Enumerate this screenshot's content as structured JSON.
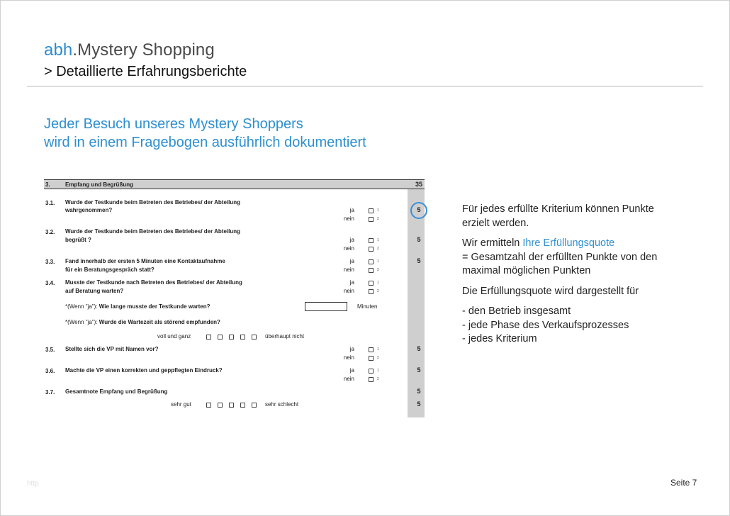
{
  "header": {
    "brand_accent": "abh",
    "brand_rest": ".Mystery Shopping",
    "subtitle": "> Detaillierte Erfahrungsberichte"
  },
  "headline": {
    "line1": "Jeder Besuch unseres Mystery Shoppers",
    "line2": "wird in einem Fragebogen ausführlich dokumentiert"
  },
  "form": {
    "section": {
      "num": "3.",
      "title": "Empfang und Begrüßung",
      "points": "35"
    },
    "questions": [
      {
        "num": "3.1.",
        "line1": "Wurde der Testkunde beim Betreten des Betriebes/ der Abteilung",
        "line2": "wahrgenommen?",
        "yes": "ja",
        "no": "nein",
        "c1": "1",
        "c2": "2",
        "points": "5"
      },
      {
        "num": "3.2.",
        "line1": "Wurde der Testkunde beim Betreten des Betriebes/ der Abteilung",
        "line2": "begrüßt ?",
        "yes": "ja",
        "no": "nein",
        "c1": "1",
        "c2": "2",
        "points": "5"
      },
      {
        "num": "3.3.",
        "line1": "Fand innerhalb der ersten 5 Minuten eine Kontaktaufnahme",
        "line2": "für ein Beratungsgespräch statt?",
        "yes": "ja",
        "no": "nein",
        "c1": "1",
        "c2": "2",
        "points": "5"
      },
      {
        "num": "3.4.",
        "line1": "Musste der Testkunde nach Betreten des Betriebes/ der Abteilung",
        "line2": "auf Beratung warten?",
        "yes": "ja",
        "no": "nein",
        "c1": "1",
        "c2": "2"
      }
    ],
    "wait_prefix": "*(Wenn \"ja\"): ",
    "wait_question": "Wie lange musste der Testkunde warten?",
    "wait_unit": "Minuten",
    "disturb_prefix": "*(Wenn \"ja\"): ",
    "disturb_question": "Wurde die Wartezeit als störend empfunden?",
    "scale1_left": "voll und ganz",
    "scale1_right": "überhaupt nicht",
    "questions2": [
      {
        "num": "3.5.",
        "line1": "Stellte sich die VP mit Namen vor?",
        "yes": "ja",
        "no": "nein",
        "c1": "1",
        "c2": "2",
        "points": "5"
      },
      {
        "num": "3.6.",
        "line1": "Machte die VP einen korrekten und geppflegten Eindruck?",
        "yes": "ja",
        "no": "nein",
        "c1": "1",
        "c2": "2",
        "points": "5"
      }
    ],
    "overall": {
      "num": "3.7.",
      "title": "Gesamtnote Empfang und Begrüßung",
      "points": "5"
    },
    "scale2_left": "sehr gut",
    "scale2_right": "sehr schlecht",
    "scale2_points": "5"
  },
  "right": {
    "p1": "Für jedes erfüllte Kriterium können Punkte erzielt werden.",
    "p2_pre": "Wir ermitteln ",
    "p2_accent": "Ihre Erfüllungsquote",
    "p2_post": "= Gesamtzahl der erfüllten Punkte von den maximal möglichen Punkten",
    "p3": "Die Erfüllungsquote wird dargestellt für",
    "list": [
      "- den Betrieb insgesamt",
      "- jede Phase des Verkaufsprozesses",
      "- jedes Kriterium"
    ]
  },
  "footer": {
    "left": "http",
    "page": "Seite 7"
  },
  "colors": {
    "accent": "#2e8fd0",
    "grey_column": "#cfcfcf"
  }
}
